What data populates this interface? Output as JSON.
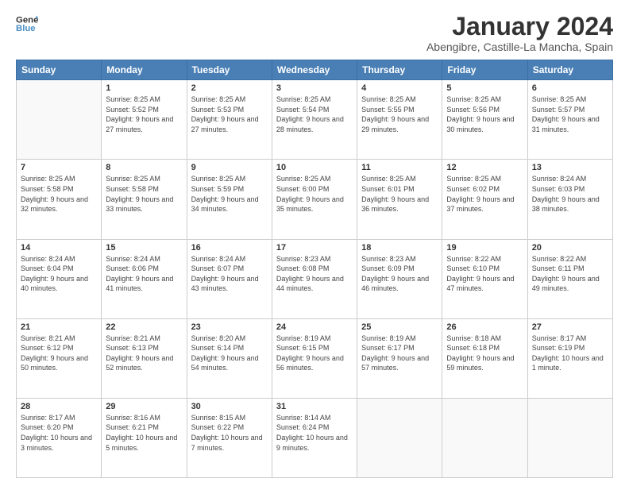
{
  "header": {
    "logo_line1": "General",
    "logo_line2": "Blue",
    "month": "January 2024",
    "location": "Abengibre, Castille-La Mancha, Spain"
  },
  "weekdays": [
    "Sunday",
    "Monday",
    "Tuesday",
    "Wednesday",
    "Thursday",
    "Friday",
    "Saturday"
  ],
  "weeks": [
    [
      {
        "day": "",
        "sunrise": "",
        "sunset": "",
        "daylight": ""
      },
      {
        "day": "1",
        "sunrise": "8:25 AM",
        "sunset": "5:52 PM",
        "daylight": "9 hours and 27 minutes."
      },
      {
        "day": "2",
        "sunrise": "8:25 AM",
        "sunset": "5:53 PM",
        "daylight": "9 hours and 27 minutes."
      },
      {
        "day": "3",
        "sunrise": "8:25 AM",
        "sunset": "5:54 PM",
        "daylight": "9 hours and 28 minutes."
      },
      {
        "day": "4",
        "sunrise": "8:25 AM",
        "sunset": "5:55 PM",
        "daylight": "9 hours and 29 minutes."
      },
      {
        "day": "5",
        "sunrise": "8:25 AM",
        "sunset": "5:56 PM",
        "daylight": "9 hours and 30 minutes."
      },
      {
        "day": "6",
        "sunrise": "8:25 AM",
        "sunset": "5:57 PM",
        "daylight": "9 hours and 31 minutes."
      }
    ],
    [
      {
        "day": "7",
        "sunrise": "8:25 AM",
        "sunset": "5:58 PM",
        "daylight": "9 hours and 32 minutes."
      },
      {
        "day": "8",
        "sunrise": "8:25 AM",
        "sunset": "5:58 PM",
        "daylight": "9 hours and 33 minutes."
      },
      {
        "day": "9",
        "sunrise": "8:25 AM",
        "sunset": "5:59 PM",
        "daylight": "9 hours and 34 minutes."
      },
      {
        "day": "10",
        "sunrise": "8:25 AM",
        "sunset": "6:00 PM",
        "daylight": "9 hours and 35 minutes."
      },
      {
        "day": "11",
        "sunrise": "8:25 AM",
        "sunset": "6:01 PM",
        "daylight": "9 hours and 36 minutes."
      },
      {
        "day": "12",
        "sunrise": "8:25 AM",
        "sunset": "6:02 PM",
        "daylight": "9 hours and 37 minutes."
      },
      {
        "day": "13",
        "sunrise": "8:24 AM",
        "sunset": "6:03 PM",
        "daylight": "9 hours and 38 minutes."
      }
    ],
    [
      {
        "day": "14",
        "sunrise": "8:24 AM",
        "sunset": "6:04 PM",
        "daylight": "9 hours and 40 minutes."
      },
      {
        "day": "15",
        "sunrise": "8:24 AM",
        "sunset": "6:06 PM",
        "daylight": "9 hours and 41 minutes."
      },
      {
        "day": "16",
        "sunrise": "8:24 AM",
        "sunset": "6:07 PM",
        "daylight": "9 hours and 43 minutes."
      },
      {
        "day": "17",
        "sunrise": "8:23 AM",
        "sunset": "6:08 PM",
        "daylight": "9 hours and 44 minutes."
      },
      {
        "day": "18",
        "sunrise": "8:23 AM",
        "sunset": "6:09 PM",
        "daylight": "9 hours and 46 minutes."
      },
      {
        "day": "19",
        "sunrise": "8:22 AM",
        "sunset": "6:10 PM",
        "daylight": "9 hours and 47 minutes."
      },
      {
        "day": "20",
        "sunrise": "8:22 AM",
        "sunset": "6:11 PM",
        "daylight": "9 hours and 49 minutes."
      }
    ],
    [
      {
        "day": "21",
        "sunrise": "8:21 AM",
        "sunset": "6:12 PM",
        "daylight": "9 hours and 50 minutes."
      },
      {
        "day": "22",
        "sunrise": "8:21 AM",
        "sunset": "6:13 PM",
        "daylight": "9 hours and 52 minutes."
      },
      {
        "day": "23",
        "sunrise": "8:20 AM",
        "sunset": "6:14 PM",
        "daylight": "9 hours and 54 minutes."
      },
      {
        "day": "24",
        "sunrise": "8:19 AM",
        "sunset": "6:15 PM",
        "daylight": "9 hours and 56 minutes."
      },
      {
        "day": "25",
        "sunrise": "8:19 AM",
        "sunset": "6:17 PM",
        "daylight": "9 hours and 57 minutes."
      },
      {
        "day": "26",
        "sunrise": "8:18 AM",
        "sunset": "6:18 PM",
        "daylight": "9 hours and 59 minutes."
      },
      {
        "day": "27",
        "sunrise": "8:17 AM",
        "sunset": "6:19 PM",
        "daylight": "10 hours and 1 minute."
      }
    ],
    [
      {
        "day": "28",
        "sunrise": "8:17 AM",
        "sunset": "6:20 PM",
        "daylight": "10 hours and 3 minutes."
      },
      {
        "day": "29",
        "sunrise": "8:16 AM",
        "sunset": "6:21 PM",
        "daylight": "10 hours and 5 minutes."
      },
      {
        "day": "30",
        "sunrise": "8:15 AM",
        "sunset": "6:22 PM",
        "daylight": "10 hours and 7 minutes."
      },
      {
        "day": "31",
        "sunrise": "8:14 AM",
        "sunset": "6:24 PM",
        "daylight": "10 hours and 9 minutes."
      },
      {
        "day": "",
        "sunrise": "",
        "sunset": "",
        "daylight": ""
      },
      {
        "day": "",
        "sunrise": "",
        "sunset": "",
        "daylight": ""
      },
      {
        "day": "",
        "sunrise": "",
        "sunset": "",
        "daylight": ""
      }
    ]
  ]
}
